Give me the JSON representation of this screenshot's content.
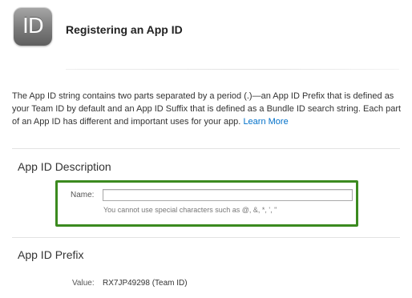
{
  "header": {
    "icon_text": "ID",
    "title": "Registering an App ID"
  },
  "intro": {
    "text": "The App ID string contains two parts separated by a period (.)—an App ID Prefix that is defined as your Team ID by default and an App ID Suffix that is defined as a Bundle ID search string. Each part of an App ID has different and important uses for your app.",
    "link_label": "Learn More"
  },
  "description_section": {
    "title": "App ID Description",
    "name_label": "Name:",
    "name_value": "",
    "name_hint": "You cannot use special characters such as @, &, *, ', \""
  },
  "prefix_section": {
    "title": "App ID Prefix",
    "value_label": "Value:",
    "value": "RX7JP49298 (Team ID)"
  },
  "colors": {
    "highlight_border": "#3b8a1f",
    "link": "#0070c9"
  }
}
